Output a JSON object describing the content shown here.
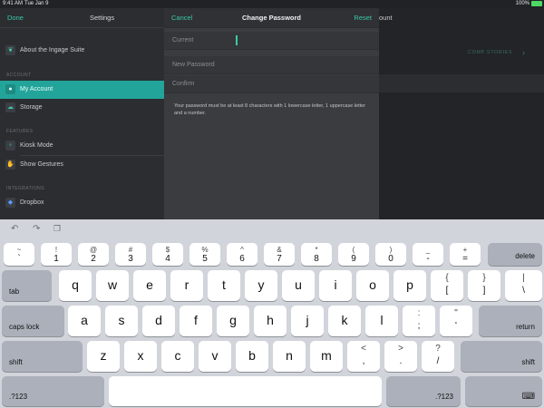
{
  "status_bar": {
    "time": "9:41 AM",
    "date": "Tue Jan 9",
    "battery": "100%"
  },
  "settings": {
    "done": "Done",
    "title": "Settings",
    "items_top": [
      {
        "label": "About the Ingage Suite",
        "icon": "leaf-icon"
      }
    ],
    "account_section": "ACCOUNT",
    "account_items": [
      {
        "label": "My Account",
        "icon": "person-icon",
        "active": true
      },
      {
        "label": "Storage",
        "icon": "cloud-icon"
      }
    ],
    "features_section": "FEATURES",
    "features_items": [
      {
        "label": "Kiosk Mode",
        "icon": "kiosk-icon"
      },
      {
        "label": "Show Gestures",
        "icon": "hand-icon"
      }
    ],
    "integrations_section": "INTEGRATIONS",
    "integrations_items": [
      {
        "label": "Dropbox",
        "icon": "dropbox-icon"
      }
    ]
  },
  "right_panel": {
    "title_fragment": "ount",
    "comp_stories": "COMP STORIES"
  },
  "modal": {
    "cancel": "Cancel",
    "title": "Change Password",
    "reset": "Reset",
    "fields": [
      {
        "placeholder": "Current",
        "value": ""
      },
      {
        "placeholder": "New Password",
        "value": ""
      },
      {
        "placeholder": "Confirm",
        "value": ""
      }
    ],
    "hint": "Your password must be at least 8 characters with 1 lowercase letter, 1 uppercase letter and a number."
  },
  "keyboard": {
    "toolbar": [
      "undo-icon",
      "redo-icon",
      "paste-icon"
    ],
    "row1": [
      {
        "top": "~",
        "bottom": "`"
      },
      {
        "top": "!",
        "bottom": "1"
      },
      {
        "top": "@",
        "bottom": "2"
      },
      {
        "top": "#",
        "bottom": "3"
      },
      {
        "top": "$",
        "bottom": "4"
      },
      {
        "top": "%",
        "bottom": "5"
      },
      {
        "top": "^",
        "bottom": "6"
      },
      {
        "top": "&",
        "bottom": "7"
      },
      {
        "top": "*",
        "bottom": "8"
      },
      {
        "top": "(",
        "bottom": "9"
      },
      {
        "top": ")",
        "bottom": "0"
      },
      {
        "top": "_",
        "bottom": "-"
      },
      {
        "top": "+",
        "bottom": "="
      }
    ],
    "delete": "delete",
    "tab": "tab",
    "row2": [
      "q",
      "w",
      "e",
      "r",
      "t",
      "y",
      "u",
      "i",
      "o",
      "p"
    ],
    "row2_brackets": [
      {
        "top": "{",
        "bottom": "["
      },
      {
        "top": "}",
        "bottom": "]"
      },
      {
        "top": "|",
        "bottom": "\\"
      }
    ],
    "caps_lock": "caps lock",
    "row3": [
      "a",
      "s",
      "d",
      "f",
      "g",
      "h",
      "j",
      "k",
      "l"
    ],
    "row3_punct": [
      {
        "top": ":",
        "bottom": ";"
      },
      {
        "top": "\"",
        "bottom": "'"
      }
    ],
    "return": "return",
    "shift": "shift",
    "row4": [
      "z",
      "x",
      "c",
      "v",
      "b",
      "n",
      "m"
    ],
    "row4_punct": [
      {
        "top": "<",
        "bottom": ","
      },
      {
        "top": ">",
        "bottom": "."
      },
      {
        "top": "?",
        "bottom": "/"
      }
    ],
    "numbers_key": ".?123",
    "dismiss_icon": "keyboard-dismiss-icon"
  }
}
